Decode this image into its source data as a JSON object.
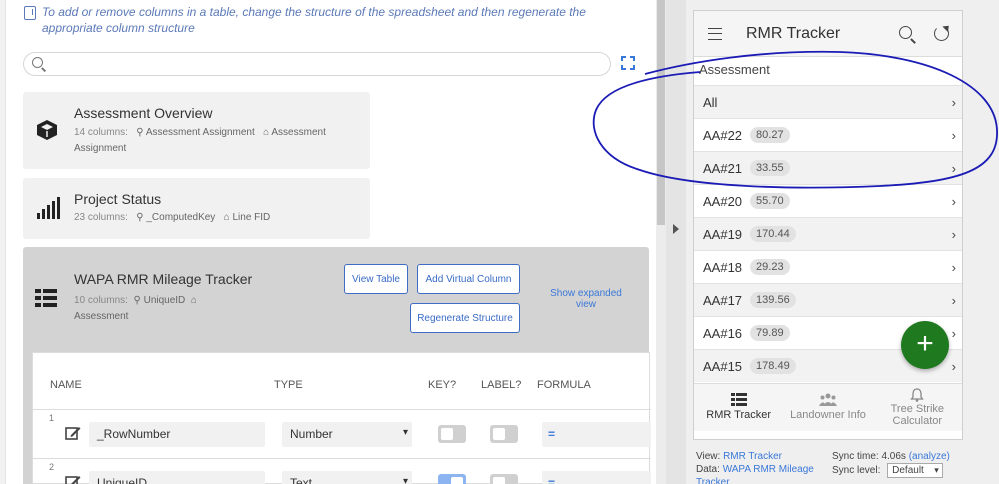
{
  "editor": {
    "info_text": "To add or remove columns in a table, change the structure of the spreadsheet and then regenerate the appropriate column structure",
    "search_placeholder": ""
  },
  "tables": [
    {
      "title": "Assessment Overview",
      "columns": "14 columns:",
      "key": "Assessment Assignment",
      "label": "Assessment Assignment",
      "icon": "cube-icon"
    },
    {
      "title": "Project Status",
      "columns": "23 columns:",
      "key": "_ComputedKey",
      "label": "Line FID",
      "icon": "signal-bars-icon"
    },
    {
      "title": "WAPA RMR Mileage Tracker",
      "columns": "10 columns:",
      "key": "UniqueID",
      "label": "Assessment",
      "icon": "table-grid-icon"
    }
  ],
  "selected_table": {
    "view_table_label": "View Table",
    "add_virtual_column_label": "Add Virtual Column",
    "regenerate_label": "Regenerate Structure",
    "show_expanded_label": "Show expanded view",
    "headers": [
      "NAME",
      "TYPE",
      "KEY?",
      "LABEL?",
      "FORMULA"
    ],
    "rows": [
      {
        "num": "1",
        "name": "_RowNumber",
        "type": "Number",
        "key": false,
        "label": false,
        "formula": "="
      },
      {
        "num": "2",
        "name": "UniqueID",
        "type": "Text",
        "key": true,
        "label": false,
        "formula": "="
      }
    ]
  },
  "preview": {
    "app_title": "RMR Tracker",
    "section": "Assessment",
    "items": [
      {
        "label": "All",
        "value": ""
      },
      {
        "label": "AA#22",
        "value": "80.27"
      },
      {
        "label": "AA#21",
        "value": "33.55"
      },
      {
        "label": "AA#20",
        "value": "55.70"
      },
      {
        "label": "AA#19",
        "value": "170.44"
      },
      {
        "label": "AA#18",
        "value": "29.23"
      },
      {
        "label": "AA#17",
        "value": "139.56"
      },
      {
        "label": "AA#16",
        "value": "79.89"
      },
      {
        "label": "AA#15",
        "value": "178.49"
      }
    ],
    "fab_label": "+",
    "nav": [
      {
        "label": "RMR Tracker",
        "icon": "table-icon",
        "active": true
      },
      {
        "label": "Landowner Info",
        "icon": "people-icon",
        "active": false
      },
      {
        "label": "Tree Strike Calculator",
        "icon": "bell-icon",
        "active": false
      }
    ]
  },
  "footer": {
    "view_prefix": "View:",
    "view_link": "RMR Tracker",
    "data_prefix": "Data:",
    "data_link": "WAPA RMR Mileage Tracker",
    "sync_time_prefix": "Sync time: 4.06s",
    "analyze_link": "(analyze)",
    "sync_level_prefix": "Sync level:",
    "sync_level_value": "Default"
  },
  "colors": {
    "accent": "#3a78d8",
    "annotation": "#1b1bb5",
    "fab": "#1f7a1f",
    "selected_table_bg": "#d3d3d3"
  }
}
